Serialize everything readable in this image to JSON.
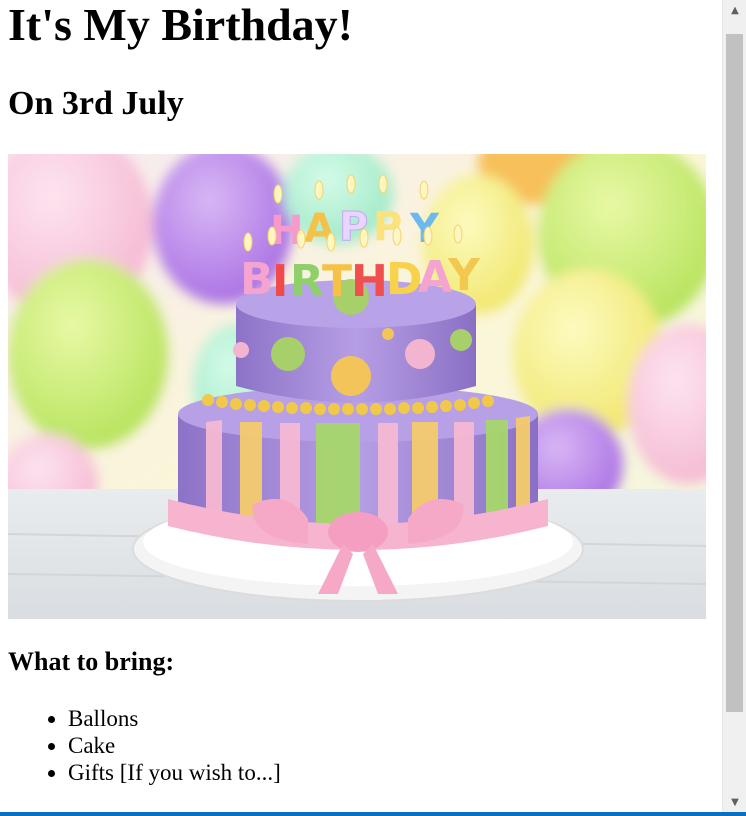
{
  "page": {
    "title": "It's My Birthday!",
    "subtitle": "On 3rd July",
    "hero_image": {
      "alt": "birthday-cake-image",
      "candle_text_top": "HAPPY",
      "candle_text_bottom": "BIRTHDAY"
    },
    "bring_heading": "What to bring:",
    "bring_items": [
      "Ballons",
      "Cake",
      "Gifts [If you wish to...]"
    ]
  },
  "scrollbar": {
    "up_arrow": "▲",
    "down_arrow": "▼"
  },
  "colors": {
    "accent_bar": "#0a6fc2",
    "scroll_thumb": "#c1c1c1",
    "scroll_track": "#f0f0f0"
  }
}
